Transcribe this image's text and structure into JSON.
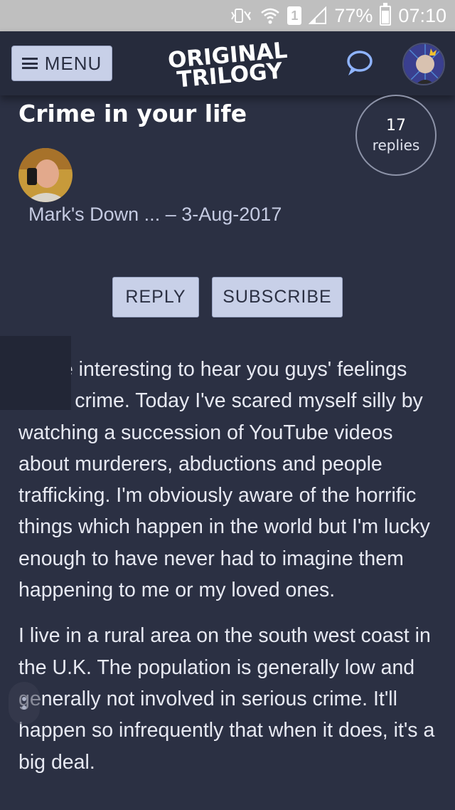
{
  "status_bar": {
    "battery": "77%",
    "time": "07:10",
    "sim_slot": "1",
    "icons": [
      "mute-vibrate-icon",
      "wifi-icon",
      "sim-icon",
      "signal-icon",
      "battery-icon"
    ]
  },
  "header": {
    "menu_label": "MENU",
    "logo_line1": "ORIGINAL",
    "logo_line2": "TRILOGY",
    "icons": [
      "hamburger-icon",
      "chat-bubble-icon",
      "user-avatar"
    ]
  },
  "thread": {
    "title": "Crime in your life",
    "replies_count": "17",
    "replies_label": "replies",
    "author": "Mark's Down ...",
    "date_separator": " – ",
    "date": "3-Aug-2017",
    "reply_label": "REPLY",
    "subscribe_label": "SUBSCRIBE"
  },
  "post": {
    "paragraphs": [
      "It'd be interesting to hear you guys' feelings about crime. Today I've scared myself silly by watching a succession of YouTube videos about murderers, abductions and people trafficking. I'm obviously aware of the horrific things which happen in the world but I'm lucky enough to have never had to imagine them happening to me or my loved ones.",
      "I live in a rural area on the south west coast in the U.K. The population is generally low and generally not involved in serious crime. It'll happen so infrequently that when it does, it's a big deal."
    ]
  },
  "colors": {
    "background": "#2b3043",
    "header": "#262b3c",
    "button": "#c8d0e8",
    "status_bar": "#bfbfbf"
  }
}
